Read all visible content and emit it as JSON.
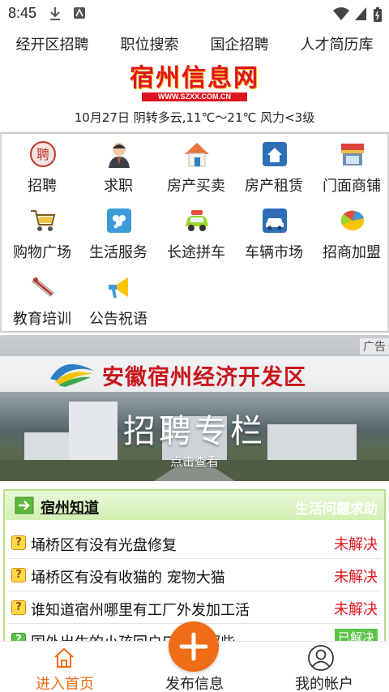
{
  "status_bar": {
    "time": "8:45"
  },
  "top_nav": [
    "经开区招聘",
    "职位搜索",
    "国企招聘",
    "人才简历库"
  ],
  "logo": {
    "text": "宿州信息网",
    "url_text": "WWW.SZXX.COM.CN"
  },
  "weather": "10月27日 阴转多云,11℃～21℃ 风力<3级",
  "categories": [
    {
      "label": "招聘",
      "icon": "pin-icon"
    },
    {
      "label": "求职",
      "icon": "person-icon"
    },
    {
      "label": "房产买卖",
      "icon": "house-icon"
    },
    {
      "label": "房产租赁",
      "icon": "building-icon"
    },
    {
      "label": "门面商铺",
      "icon": "shop-icon"
    },
    {
      "label": "购物广场",
      "icon": "cart-icon"
    },
    {
      "label": "生活服务",
      "icon": "flower-icon"
    },
    {
      "label": "长途拼车",
      "icon": "car-icon"
    },
    {
      "label": "车辆市场",
      "icon": "vehicle-icon"
    },
    {
      "label": "招商加盟",
      "icon": "coins-icon"
    },
    {
      "label": "教育培训",
      "icon": "diploma-icon"
    },
    {
      "label": "公告祝语",
      "icon": "megaphone-icon"
    }
  ],
  "banner": {
    "headline": "安徽宿州经济开发区",
    "subheadline": "招聘专栏",
    "cta": "点击查看",
    "ad_label": "广告"
  },
  "zhidao": {
    "title": "宿州知道",
    "subtitle": "生活问题求助",
    "rows": [
      {
        "question": "埇桥区有没有光盘修复",
        "status": "未解决",
        "solved": false
      },
      {
        "question": "埇桥区有没有收猫的 宠物大猫",
        "status": "未解决",
        "solved": false
      },
      {
        "question": "谁知道宿州哪里有工厂外发加工活",
        "status": "未解决",
        "solved": false
      },
      {
        "question": "国外出生的小孩回户口需要哪些",
        "status": "已解决",
        "solved": true
      }
    ]
  },
  "bottom_nav": {
    "home": "进入首页",
    "publish": "发布信息",
    "account": "我的帐户"
  },
  "colors": {
    "brand_red": "#e0141e",
    "accent_orange": "#f06d17",
    "green_header": "#d2f0b3"
  }
}
